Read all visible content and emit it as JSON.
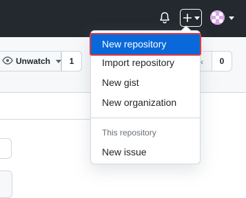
{
  "header": {
    "notifications_icon": "bell-icon",
    "create_icon": "plus-icon",
    "avatar_icon": "avatar"
  },
  "repo_actions": {
    "watch_label": "Unwatch",
    "watch_count": "1",
    "star_count": "0"
  },
  "create_menu": {
    "items": [
      {
        "label": "New repository"
      },
      {
        "label": "Import repository"
      },
      {
        "label": "New gist"
      },
      {
        "label": "New organization"
      }
    ],
    "section_header": "This repository",
    "section_items": [
      {
        "label": "New issue"
      }
    ]
  },
  "colors": {
    "header_bg": "#24292f",
    "accent": "#0969da",
    "highlight_border": "#e8373a"
  }
}
